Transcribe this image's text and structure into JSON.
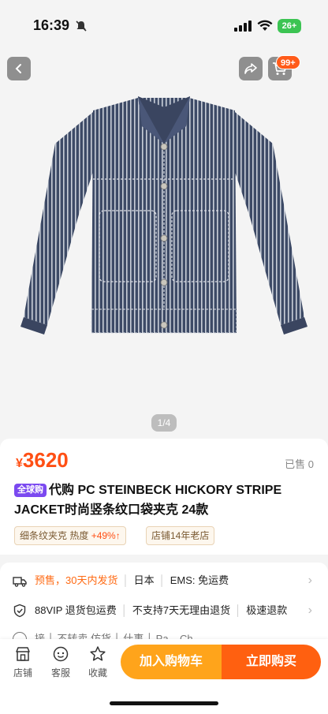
{
  "status_bar": {
    "time": "16:39",
    "battery": "26+"
  },
  "gallery": {
    "pager": "1/4",
    "cart_badge": "99+"
  },
  "product": {
    "price_symbol": "¥",
    "price": "3620",
    "sold": "已售 0",
    "global_tag": "全球购",
    "title": "代购 PC STEINBECK HICKORY STRIPE JACKET时尚竖条纹口袋夹克 24款",
    "chips": [
      {
        "label": "细条纹夹克 热度",
        "highlight": "+49%↑"
      },
      {
        "label": "店铺14年老店",
        "highlight": ""
      }
    ]
  },
  "services": {
    "shipping": {
      "presale": "预售，30天内发货",
      "origin": "日本",
      "ems": "EMS: 免运费"
    },
    "guarantee": {
      "items": [
        "88VIP 退货包运费",
        "不支持7天无理由退货",
        "极速退款"
      ]
    },
    "partial": "接  │ 不转卖 仿货  │  什事  │ Pa... Ch..."
  },
  "bottom": {
    "tabs": [
      {
        "label": "店铺",
        "icon": "store-icon"
      },
      {
        "label": "客服",
        "icon": "customer-service-icon"
      },
      {
        "label": "收藏",
        "icon": "star-icon"
      }
    ],
    "add_to_cart": "加入购物车",
    "buy_now": "立即购买"
  },
  "colors": {
    "accent": "#ff4f14",
    "cart_button": "#ffa41b",
    "buy_button": "#ff6010",
    "global_tag": "#7b49f0"
  }
}
